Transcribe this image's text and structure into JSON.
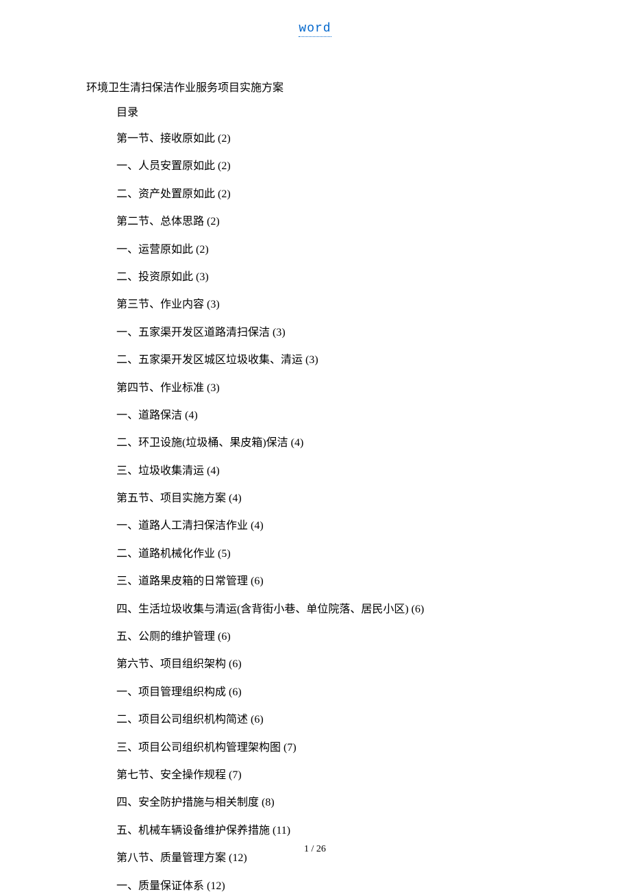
{
  "header": {
    "link_text": "word"
  },
  "document": {
    "title": "环境卫生清扫保洁作业服务项目实施方案",
    "toc_header": "目录"
  },
  "toc": [
    {
      "label": "第一节、接收原如此 (2)"
    },
    {
      "label": "一、人员安置原如此 (2)"
    },
    {
      "label": "二、资产处置原如此 (2)"
    },
    {
      "label": "第二节、总体思路 (2)"
    },
    {
      "label": "一、运营原如此 (2)"
    },
    {
      "label": "二、投资原如此 (3)"
    },
    {
      "label": "第三节、作业内容 (3)"
    },
    {
      "label": "一、五家渠开发区道路清扫保洁 (3)"
    },
    {
      "label": "二、五家渠开发区城区垃圾收集、清运 (3)"
    },
    {
      "label": "第四节、作业标准 (3)"
    },
    {
      "label": "一、道路保洁 (4)"
    },
    {
      "label": "二、环卫设施(垃圾桶、果皮箱)保洁 (4)"
    },
    {
      "label": "三、垃圾收集清运 (4)"
    },
    {
      "label": "第五节、项目实施方案 (4)"
    },
    {
      "label": "一、道路人工清扫保洁作业 (4)"
    },
    {
      "label": "二、道路机械化作业 (5)"
    },
    {
      "label": "三、道路果皮箱的日常管理 (6)"
    },
    {
      "label": "四、生活垃圾收集与清运(含背街小巷、单位院落、居民小区) (6)"
    },
    {
      "label": "五、公厕的维护管理 (6)"
    },
    {
      "label": "第六节、项目组织架构 (6)"
    },
    {
      "label": "一、项目管理组织构成 (6)"
    },
    {
      "label": "二、项目公司组织机构简述 (6)"
    },
    {
      "label": "三、项目公司组织机构管理架构图 (7)"
    },
    {
      "label": "第七节、安全操作规程 (7)"
    },
    {
      "label": "四、安全防护措施与相关制度 (8)"
    },
    {
      "label": "五、机械车辆设备维护保养措施 (11)"
    },
    {
      "label": "第八节、质量管理方案 (12)"
    },
    {
      "label": "一、质量保证体系 (12)"
    }
  ],
  "footer": {
    "page_indicator": "1 / 26"
  }
}
